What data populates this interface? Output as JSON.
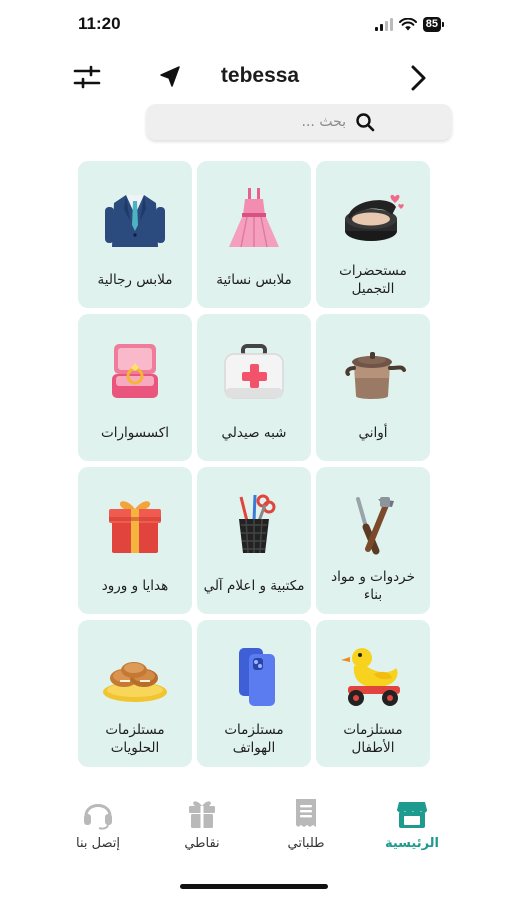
{
  "status_bar": {
    "time": "11:20",
    "battery": "85"
  },
  "header": {
    "city": "tebessa"
  },
  "search": {
    "placeholder": "بحث ..."
  },
  "categories": [
    {
      "label": "مستحضرات التجميل",
      "icon": "cosmetics-icon"
    },
    {
      "label": "ملابس نسائية",
      "icon": "dress-icon"
    },
    {
      "label": "ملابس رجالية",
      "icon": "suit-icon"
    },
    {
      "label": "أواني",
      "icon": "pot-icon"
    },
    {
      "label": "شبه صيدلي",
      "icon": "first-aid-icon"
    },
    {
      "label": "اكسسوارات",
      "icon": "ring-box-icon"
    },
    {
      "label": "خردوات و مواد بناء",
      "icon": "tools-icon"
    },
    {
      "label": "مكتبية و اعلام آلي",
      "icon": "pen-holder-icon"
    },
    {
      "label": "هدايا و ورود",
      "icon": "gift-icon"
    },
    {
      "label": "مستلزمات الأطفال",
      "icon": "toy-duck-icon"
    },
    {
      "label": "مستلزمات الهواتف",
      "icon": "phones-icon"
    },
    {
      "label": "مستلزمات الحلويات",
      "icon": "sweets-icon"
    }
  ],
  "nav": {
    "home": "الرئيسية",
    "orders": "طلباتي",
    "points": "نقاطي",
    "contact": "إتصل بنا"
  },
  "colors": {
    "accent": "#1f9a8e",
    "tile_bg": "#dff2ee",
    "nav_inactive": "#b9b9b9"
  }
}
